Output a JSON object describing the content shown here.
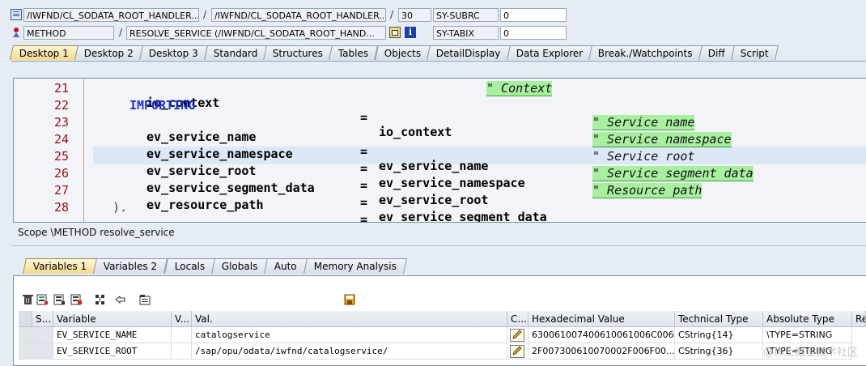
{
  "header": {
    "row1": {
      "program": "/IWFND/CL_SODATA_ROOT_HANDLER...",
      "include": "/IWFND/CL_SODATA_ROOT_HANDLER...",
      "line": "30",
      "sy_label": "SY-SUBRC",
      "sy_value": "0"
    },
    "row2": {
      "type": "METHOD",
      "method": "RESOLVE_SERVICE (/IWFND/CL_SODATA_ROOT_HAND...",
      "sy_label": "SY-TABIX",
      "sy_value": "0"
    },
    "separator": "/"
  },
  "tabs": [
    {
      "label": "Desktop 1",
      "active": true
    },
    {
      "label": "Desktop 2"
    },
    {
      "label": "Desktop 3"
    },
    {
      "label": "Standard"
    },
    {
      "label": "Structures"
    },
    {
      "label": "Tables"
    },
    {
      "label": "Objects"
    },
    {
      "label": "DetailDisplay"
    },
    {
      "label": "Data Explorer"
    },
    {
      "label": "Break./Watchpoints"
    },
    {
      "label": "Diff"
    },
    {
      "label": "Script"
    }
  ],
  "code": {
    "lines": [
      {
        "num": "21",
        "param": "io_context",
        "eq": "=",
        "val": "io_context",
        "comment": "\" Context"
      },
      {
        "num": "22",
        "keyword": "IMPORTING"
      },
      {
        "num": "23",
        "param": "ev_service_name",
        "eq": "=",
        "val": "ev_service_name",
        "comment": "\" Service name"
      },
      {
        "num": "24",
        "param": "ev_service_namespace",
        "eq": "=",
        "val": "ev_service_namespace",
        "comment": "\" Service namespace"
      },
      {
        "num": "25",
        "param": "ev_service_root",
        "eq": "=",
        "val": "ev_service_root",
        "comment": "\" Service root"
      },
      {
        "num": "26",
        "param": "ev_service_segment_data",
        "eq": "=",
        "val": "ev_service_segment_data",
        "comment": "\" Service segment data"
      },
      {
        "num": "27",
        "param": "ev_resource_path",
        "eq": "=",
        "val": "ev_resource_path",
        "comment": "\" Resource path"
      },
      {
        "num": "28",
        "closing": ")."
      }
    ],
    "current_line": "25"
  },
  "scope": "Scope \\METHOD resolve_service",
  "bottom_tabs": [
    {
      "label": "Variables 1",
      "active": true
    },
    {
      "label": "Variables 2"
    },
    {
      "label": "Locals"
    },
    {
      "label": "Globals"
    },
    {
      "label": "Auto"
    },
    {
      "label": "Memory Analysis"
    }
  ],
  "variables": {
    "columns": [
      "S...",
      "Variable",
      "V...",
      "Val.",
      "C...",
      "Hexadecimal Value",
      "Technical Type",
      "Absolute Type",
      "Re"
    ],
    "rows": [
      {
        "variable": "EV_SERVICE_NAME",
        "value": "catalogservice",
        "hex": "630061007400610061006C006F00...",
        "tech": "CString{14}",
        "abs": "\\TYPE=STRING"
      },
      {
        "variable": "EV_SERVICE_ROOT",
        "value": "/sap/opu/odata/iwfnd/catalogservice/",
        "hex": "2F007300610070002F006F00...",
        "tech": "CString{36}",
        "abs": "\\TYPE=STRING"
      }
    ]
  },
  "watermark": "@稀土掘金技术社区",
  "colors": {
    "comment_bg": "#a8f0a0",
    "keyword": "#1a2fd6",
    "line_number": "#a01010",
    "active_tab": "#f5d98a"
  }
}
